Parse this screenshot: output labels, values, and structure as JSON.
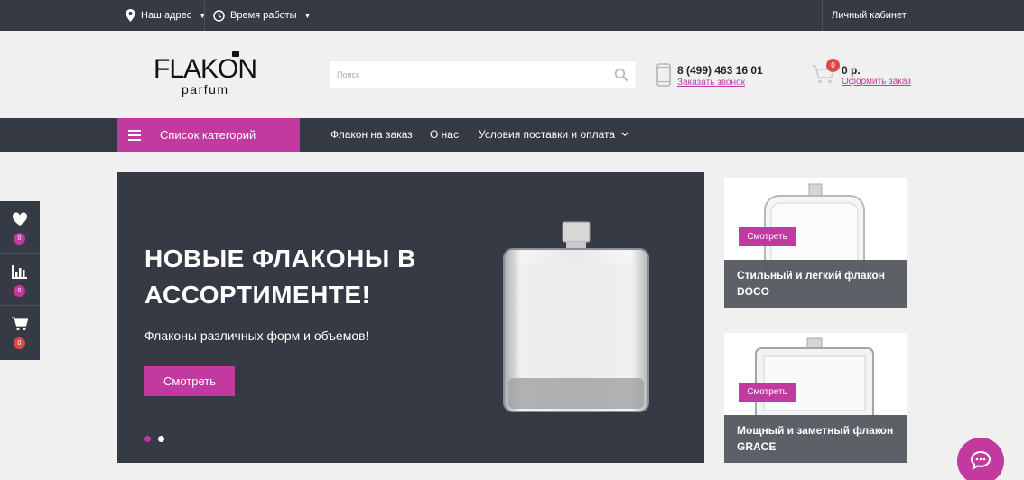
{
  "topbar": {
    "address_label": "Наш адрес",
    "hours_label": "Время работы",
    "account_label": "Личный кабинет"
  },
  "header": {
    "logo_main": "FLAKON",
    "logo_sub": "parfum",
    "search_placeholder": "Поиск",
    "phone": "8 (499) 463 16 01",
    "callback_label": "Заказать звонок",
    "cart_count": "0",
    "cart_sum": "0 р.",
    "checkout_label": "Оформить заказ"
  },
  "nav": {
    "categories_label": "Список категорий",
    "links": [
      "Флакон на заказ",
      "О нас",
      "Условия поставки и оплата"
    ]
  },
  "hero": {
    "title": "НОВЫЕ ФЛАКОНЫ В АССОРТИМЕНТЕ!",
    "subtitle": "Флаконы различных форм и объемов!",
    "button_label": "Смотреть",
    "active_dot": 0
  },
  "promos": [
    {
      "button_label": "Смотреть",
      "caption": "Стильный и легкий флакон DOCO"
    },
    {
      "button_label": "Смотреть",
      "caption": "Мощный и заметный флакон GRACE"
    }
  ],
  "floating": {
    "favorites_count": "0",
    "compare_count": "0",
    "cart_count": "0"
  },
  "colors": {
    "accent": "#c2399f",
    "dark": "#363a45",
    "badge_red": "#e04848",
    "background": "#f0f0f1"
  }
}
